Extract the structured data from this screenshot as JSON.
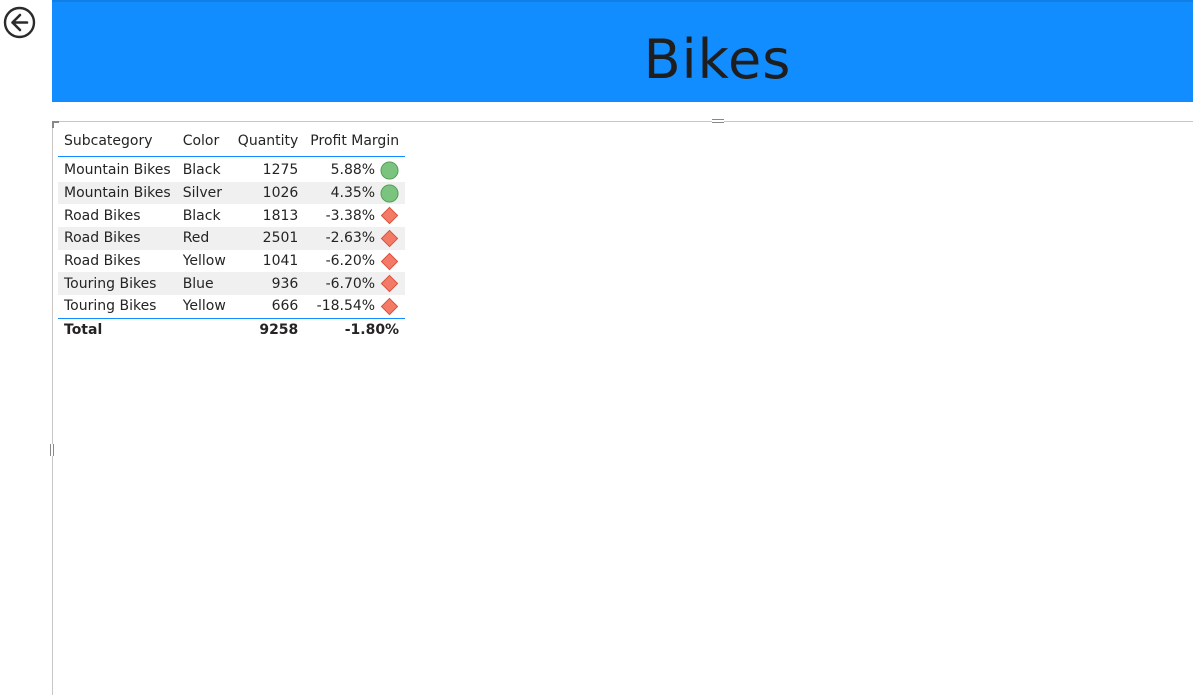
{
  "banner": {
    "title": "Bikes",
    "color": "#118dff"
  },
  "nav": {
    "back_icon": "back-arrow-circle-icon"
  },
  "table": {
    "columns": [
      "Subcategory",
      "Color",
      "Quantity",
      "Profit Margin"
    ],
    "rows": [
      {
        "subcategory": "Mountain Bikes",
        "color": "Black",
        "quantity": "1275",
        "profit_margin": "5.88%",
        "status": "good"
      },
      {
        "subcategory": "Mountain Bikes",
        "color": "Silver",
        "quantity": "1026",
        "profit_margin": "4.35%",
        "status": "good"
      },
      {
        "subcategory": "Road Bikes",
        "color": "Black",
        "quantity": "1813",
        "profit_margin": "-3.38%",
        "status": "bad"
      },
      {
        "subcategory": "Road Bikes",
        "color": "Red",
        "quantity": "2501",
        "profit_margin": "-2.63%",
        "status": "bad"
      },
      {
        "subcategory": "Road Bikes",
        "color": "Yellow",
        "quantity": "1041",
        "profit_margin": "-6.20%",
        "status": "bad"
      },
      {
        "subcategory": "Touring Bikes",
        "color": "Blue",
        "quantity": "936",
        "profit_margin": "-6.70%",
        "status": "bad"
      },
      {
        "subcategory": "Touring Bikes",
        "color": "Yellow",
        "quantity": "666",
        "profit_margin": "-18.54%",
        "status": "bad"
      }
    ],
    "total": {
      "label": "Total",
      "quantity": "9258",
      "profit_margin": "-1.80%"
    }
  },
  "kpi_icons": {
    "good": {
      "name": "green-circle-icon",
      "color": "#7bc47f",
      "stroke": "#4e9a52"
    },
    "bad": {
      "name": "red-diamond-icon",
      "color": "#f27a66",
      "stroke": "#d8503b"
    }
  }
}
